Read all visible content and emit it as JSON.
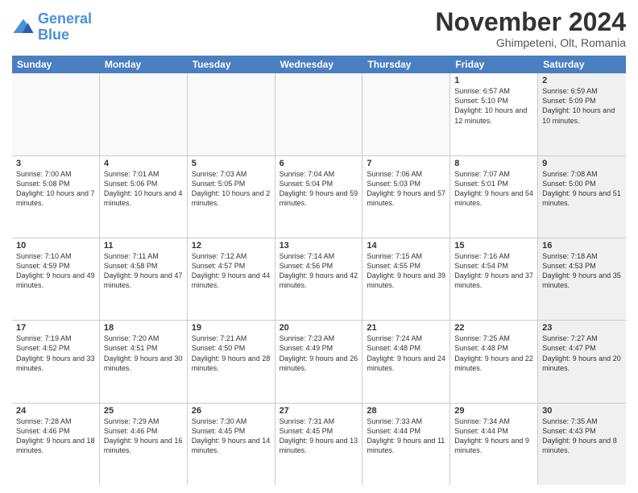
{
  "logo": {
    "line1": "General",
    "line2": "Blue"
  },
  "title": "November 2024",
  "location": "Ghimpeteni, Olt, Romania",
  "header_days": [
    "Sunday",
    "Monday",
    "Tuesday",
    "Wednesday",
    "Thursday",
    "Friday",
    "Saturday"
  ],
  "rows": [
    [
      {
        "day": "",
        "info": "",
        "empty": true
      },
      {
        "day": "",
        "info": "",
        "empty": true
      },
      {
        "day": "",
        "info": "",
        "empty": true
      },
      {
        "day": "",
        "info": "",
        "empty": true
      },
      {
        "day": "",
        "info": "",
        "empty": true
      },
      {
        "day": "1",
        "info": "Sunrise: 6:57 AM\nSunset: 5:10 PM\nDaylight: 10 hours and 12 minutes.",
        "empty": false,
        "shaded": false
      },
      {
        "day": "2",
        "info": "Sunrise: 6:59 AM\nSunset: 5:09 PM\nDaylight: 10 hours and 10 minutes.",
        "empty": false,
        "shaded": true
      }
    ],
    [
      {
        "day": "3",
        "info": "Sunrise: 7:00 AM\nSunset: 5:08 PM\nDaylight: 10 hours and 7 minutes.",
        "empty": false,
        "shaded": false
      },
      {
        "day": "4",
        "info": "Sunrise: 7:01 AM\nSunset: 5:06 PM\nDaylight: 10 hours and 4 minutes.",
        "empty": false,
        "shaded": false
      },
      {
        "day": "5",
        "info": "Sunrise: 7:03 AM\nSunset: 5:05 PM\nDaylight: 10 hours and 2 minutes.",
        "empty": false,
        "shaded": false
      },
      {
        "day": "6",
        "info": "Sunrise: 7:04 AM\nSunset: 5:04 PM\nDaylight: 9 hours and 59 minutes.",
        "empty": false,
        "shaded": false
      },
      {
        "day": "7",
        "info": "Sunrise: 7:06 AM\nSunset: 5:03 PM\nDaylight: 9 hours and 57 minutes.",
        "empty": false,
        "shaded": false
      },
      {
        "day": "8",
        "info": "Sunrise: 7:07 AM\nSunset: 5:01 PM\nDaylight: 9 hours and 54 minutes.",
        "empty": false,
        "shaded": false
      },
      {
        "day": "9",
        "info": "Sunrise: 7:08 AM\nSunset: 5:00 PM\nDaylight: 9 hours and 51 minutes.",
        "empty": false,
        "shaded": true
      }
    ],
    [
      {
        "day": "10",
        "info": "Sunrise: 7:10 AM\nSunset: 4:59 PM\nDaylight: 9 hours and 49 minutes.",
        "empty": false,
        "shaded": false
      },
      {
        "day": "11",
        "info": "Sunrise: 7:11 AM\nSunset: 4:58 PM\nDaylight: 9 hours and 47 minutes.",
        "empty": false,
        "shaded": false
      },
      {
        "day": "12",
        "info": "Sunrise: 7:12 AM\nSunset: 4:57 PM\nDaylight: 9 hours and 44 minutes.",
        "empty": false,
        "shaded": false
      },
      {
        "day": "13",
        "info": "Sunrise: 7:14 AM\nSunset: 4:56 PM\nDaylight: 9 hours and 42 minutes.",
        "empty": false,
        "shaded": false
      },
      {
        "day": "14",
        "info": "Sunrise: 7:15 AM\nSunset: 4:55 PM\nDaylight: 9 hours and 39 minutes.",
        "empty": false,
        "shaded": false
      },
      {
        "day": "15",
        "info": "Sunrise: 7:16 AM\nSunset: 4:54 PM\nDaylight: 9 hours and 37 minutes.",
        "empty": false,
        "shaded": false
      },
      {
        "day": "16",
        "info": "Sunrise: 7:18 AM\nSunset: 4:53 PM\nDaylight: 9 hours and 35 minutes.",
        "empty": false,
        "shaded": true
      }
    ],
    [
      {
        "day": "17",
        "info": "Sunrise: 7:19 AM\nSunset: 4:52 PM\nDaylight: 9 hours and 33 minutes.",
        "empty": false,
        "shaded": false
      },
      {
        "day": "18",
        "info": "Sunrise: 7:20 AM\nSunset: 4:51 PM\nDaylight: 9 hours and 30 minutes.",
        "empty": false,
        "shaded": false
      },
      {
        "day": "19",
        "info": "Sunrise: 7:21 AM\nSunset: 4:50 PM\nDaylight: 9 hours and 28 minutes.",
        "empty": false,
        "shaded": false
      },
      {
        "day": "20",
        "info": "Sunrise: 7:23 AM\nSunset: 4:49 PM\nDaylight: 9 hours and 26 minutes.",
        "empty": false,
        "shaded": false
      },
      {
        "day": "21",
        "info": "Sunrise: 7:24 AM\nSunset: 4:48 PM\nDaylight: 9 hours and 24 minutes.",
        "empty": false,
        "shaded": false
      },
      {
        "day": "22",
        "info": "Sunrise: 7:25 AM\nSunset: 4:48 PM\nDaylight: 9 hours and 22 minutes.",
        "empty": false,
        "shaded": false
      },
      {
        "day": "23",
        "info": "Sunrise: 7:27 AM\nSunset: 4:47 PM\nDaylight: 9 hours and 20 minutes.",
        "empty": false,
        "shaded": true
      }
    ],
    [
      {
        "day": "24",
        "info": "Sunrise: 7:28 AM\nSunset: 4:46 PM\nDaylight: 9 hours and 18 minutes.",
        "empty": false,
        "shaded": false
      },
      {
        "day": "25",
        "info": "Sunrise: 7:29 AM\nSunset: 4:46 PM\nDaylight: 9 hours and 16 minutes.",
        "empty": false,
        "shaded": false
      },
      {
        "day": "26",
        "info": "Sunrise: 7:30 AM\nSunset: 4:45 PM\nDaylight: 9 hours and 14 minutes.",
        "empty": false,
        "shaded": false
      },
      {
        "day": "27",
        "info": "Sunrise: 7:31 AM\nSunset: 4:45 PM\nDaylight: 9 hours and 13 minutes.",
        "empty": false,
        "shaded": false
      },
      {
        "day": "28",
        "info": "Sunrise: 7:33 AM\nSunset: 4:44 PM\nDaylight: 9 hours and 11 minutes.",
        "empty": false,
        "shaded": false
      },
      {
        "day": "29",
        "info": "Sunrise: 7:34 AM\nSunset: 4:44 PM\nDaylight: 9 hours and 9 minutes.",
        "empty": false,
        "shaded": false
      },
      {
        "day": "30",
        "info": "Sunrise: 7:35 AM\nSunset: 4:43 PM\nDaylight: 9 hours and 8 minutes.",
        "empty": false,
        "shaded": true
      }
    ]
  ]
}
